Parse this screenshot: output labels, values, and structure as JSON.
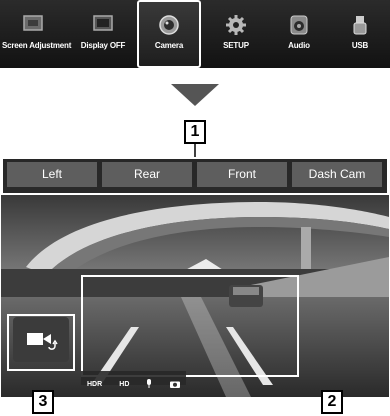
{
  "menu": {
    "items": [
      {
        "label": "Screen Adjustment",
        "icon": "screen-adjustment-icon"
      },
      {
        "label": "Display OFF",
        "icon": "display-off-icon"
      },
      {
        "label": "Camera",
        "icon": "camera-icon",
        "selected": true
      },
      {
        "label": "SETUP",
        "icon": "gear-icon"
      },
      {
        "label": "Audio",
        "icon": "audio-icon"
      },
      {
        "label": "USB",
        "icon": "usb-icon"
      }
    ]
  },
  "camera_view": {
    "buttons": [
      "Left",
      "Rear",
      "Front",
      "Dash Cam"
    ],
    "status": {
      "hdr": "HDR",
      "hd": "HD",
      "mic_icon": "mic-icon",
      "snapshot_icon": "camera-icon"
    }
  },
  "callouts": {
    "one": "1",
    "two": "2",
    "three": "3"
  }
}
